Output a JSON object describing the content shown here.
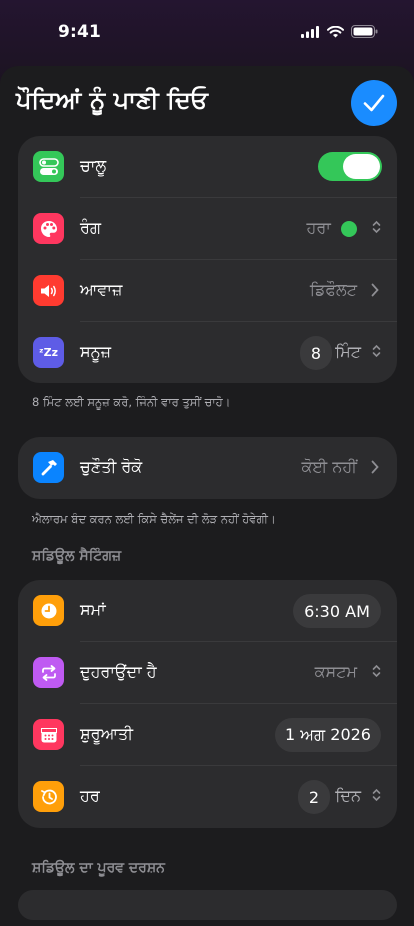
{
  "status": {
    "time": "9:41"
  },
  "title": "ਪੌਦਿਆਂ ਨੂੰ ਪਾਣੀ ਦਿਓ",
  "colors": {
    "accent": "#1a8cff",
    "toggle_on": "#34c759",
    "card": "#2c2c2e",
    "sheet": "#1c1c1e"
  },
  "main_group": {
    "enabled": {
      "label": "ਚਾਲੂ",
      "value": true,
      "icon": "toggle-icon"
    },
    "color": {
      "label": "ਰੰਗ",
      "value": "ਹਰਾ",
      "icon": "palette-icon"
    },
    "sound": {
      "label": "ਆਵਾਜ਼",
      "value": "ਡਿਫੌਲਟ",
      "icon": "speaker-icon"
    },
    "snooze": {
      "label": "ਸਨੂਜ਼",
      "number": "8",
      "unit": "ਮਿੰਟ",
      "icon": "zzz-icon"
    }
  },
  "snooze_footnote": "8 ਮਿੰਟ ਲਈ ਸਨੂਜ਼ ਕਰੋ, ਜਿੰਨੀ ਵਾਰ ਤੁਸੀਂ ਚਾਹੋ।",
  "challenge": {
    "label": "ਚੁਣੌਤੀ ਰੋਕੋ",
    "value": "ਕੋਈ ਨਹੀਂ",
    "icon": "hammer-icon"
  },
  "challenge_footnote": "ਐਲਾਰਮ ਬੰਦ ਕਰਨ ਲਈ ਕਿਸੇ ਚੈਲੇਂਜ ਦੀ ਲੋੜ ਨਹੀਂ ਹੋਵੇਗੀ।",
  "schedule": {
    "header": "ਸ਼ਡਿਊਲ ਸੈਟਿੰਗਜ਼",
    "time": {
      "label": "ਸਮਾਂ",
      "value": "6:30 AM",
      "icon": "clock-icon"
    },
    "repeat": {
      "label": "ਦੁਹਰਾਉਂਦਾ ਹੈ",
      "value": "ਕਸਟਮ",
      "icon": "repeat-icon"
    },
    "start": {
      "label": "ਸ਼ੁਰੂਆਤੀ",
      "value": "1 ਅਗ 2026",
      "icon": "calendar-icon"
    },
    "every": {
      "label": "ਹਰ",
      "number": "2",
      "unit": "ਦਿਨ",
      "icon": "history-icon"
    }
  },
  "preview_header": "ਸ਼ਡਿਊਲ ਦਾ ਪੂਰਵ ਦਰਸ਼ਨ"
}
